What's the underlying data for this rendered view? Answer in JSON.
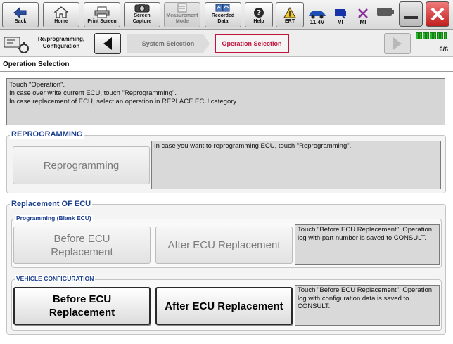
{
  "toolbar": {
    "back_label": "Back",
    "home_label": "Home",
    "print_label": "Print Screen",
    "capture_label_1": "Screen",
    "capture_label_2": "Capture",
    "measure_label_1": "Measurement",
    "measure_label_2": "Mode",
    "recorded_label_1": "Recorded",
    "recorded_label_2": "Data",
    "help_label": "Help",
    "ert_label": "ERT",
    "voltage": "11.4V",
    "vi_label": "VI",
    "mi_label": "MI"
  },
  "nav": {
    "section_title_1": "Re/programming,",
    "section_title_2": "Configuration",
    "step_prev": "System Selection",
    "step_current": "Operation Selection",
    "page_counter": "6/6"
  },
  "page_title": "Operation Selection",
  "instructions": [
    "Touch \"Operation\".",
    "In case over write current ECU, touch \"Reprogramming\".",
    "In case replacement of ECU, select an operation in REPLACE ECU category."
  ],
  "reprogramming": {
    "heading": "REPROGRAMMING",
    "button_label": "Reprogramming",
    "description": "In case you want to reprogramming ECU, touch \"Reprogramming\"."
  },
  "replacement": {
    "heading": "Replacement OF ECU",
    "programming": {
      "heading": "Programming (Blank ECU)",
      "before_line1": "Before ECU",
      "before_line2": "Replacement",
      "after_label": "After ECU Replacement",
      "description": "Touch \"Before ECU Replacement\", Operation log with part number is saved to CONSULT."
    },
    "vehicle_config": {
      "heading": "VEHICLE CONFIGURATION",
      "before_line1": "Before ECU",
      "before_line2": "Replacement",
      "after_label": "After ECU Replacement",
      "description": "Touch \"Before ECU Replacement\", Operation log with configuration data is saved to CONSULT."
    }
  },
  "colors": {
    "section_heading": "#1b3f8f",
    "current_step": "#c0143c",
    "battery_green": "#29b829"
  }
}
